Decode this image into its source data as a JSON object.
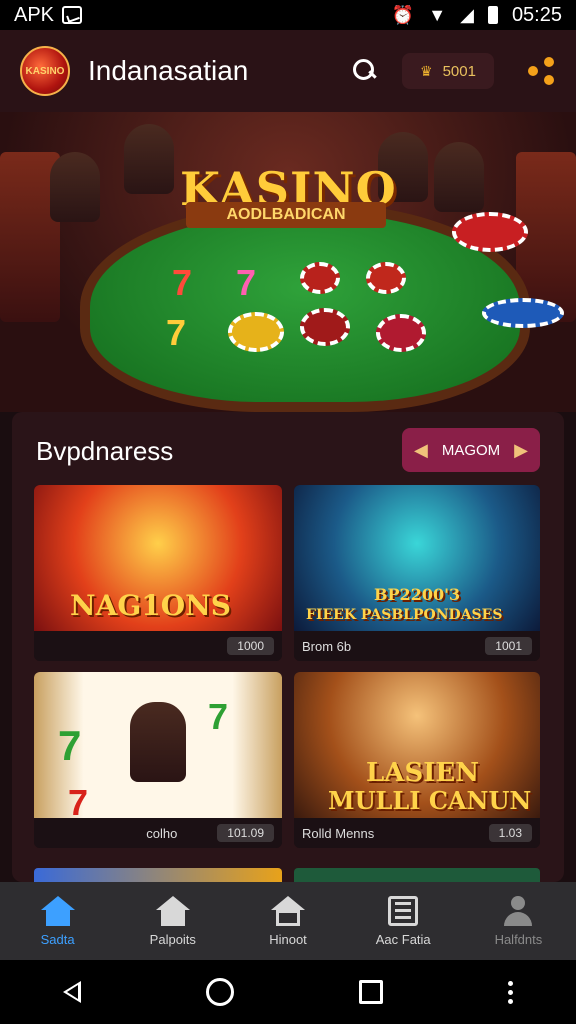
{
  "status_bar": {
    "left_label": "APK",
    "time": "05:25"
  },
  "app_bar": {
    "title": "Indanasatian",
    "coins": "5001",
    "logo_text": "KASINO"
  },
  "hero": {
    "title": "KASINO",
    "subtitle": "AODLBADICAN"
  },
  "section": {
    "title": "Bvpdnaress",
    "more_label": "MAGOM"
  },
  "cards": [
    {
      "title": "NAG1ONS",
      "footer_label": "",
      "badge": "1000"
    },
    {
      "title": "BP2200'3",
      "subtitle": "FIEEK PASBLPONDASES",
      "footer_label": "Brom 6b",
      "badge": "1001"
    },
    {
      "title": "",
      "footer_label": "colho",
      "badge": "101.09"
    },
    {
      "title": "LASIEN",
      "subtitle": "MULLI CANUN",
      "footer_label": "Rolld Menns",
      "badge": "1.03"
    }
  ],
  "nav": [
    {
      "label": "Sadta",
      "icon": "home-icon",
      "active": true
    },
    {
      "label": "Palpoits",
      "icon": "store-icon",
      "active": false
    },
    {
      "label": "Hinoot",
      "icon": "house-icon",
      "active": false
    },
    {
      "label": "Aac Fatia",
      "icon": "list-icon",
      "active": false
    },
    {
      "label": "Halfdnts",
      "icon": "profile-icon",
      "active": false
    }
  ],
  "colors": {
    "accent": "#3da0ff",
    "more_button": "#8a1f48",
    "gold": "#ffcc3a"
  }
}
